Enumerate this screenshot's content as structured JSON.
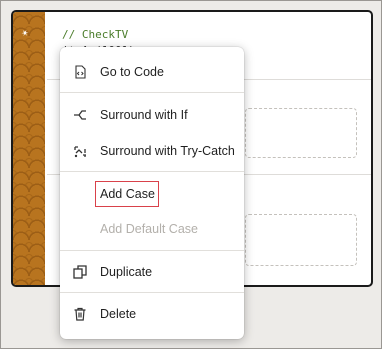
{
  "editor": {
    "code_comment": "// CheckTV",
    "code_partial": "  it A  (1001)"
  },
  "menu": {
    "items": [
      {
        "label": "Go to Code",
        "icon": "code-file-icon",
        "enabled": true
      },
      {
        "label": "Surround with If",
        "icon": "branch-icon",
        "enabled": true
      },
      {
        "label": "Surround with Try-Catch",
        "icon": "try-catch-icon",
        "enabled": true
      },
      {
        "label": "Add Case",
        "icon": "",
        "enabled": true,
        "highlighted": true
      },
      {
        "label": "Add Default Case",
        "icon": "",
        "enabled": false
      },
      {
        "label": "Duplicate",
        "icon": "duplicate-icon",
        "enabled": true
      },
      {
        "label": "Delete",
        "icon": "trash-icon",
        "enabled": true
      }
    ]
  },
  "colors": {
    "stripe": "#b8741f",
    "highlight_border": "#d9414a",
    "disabled_text": "#b3b0ab"
  }
}
